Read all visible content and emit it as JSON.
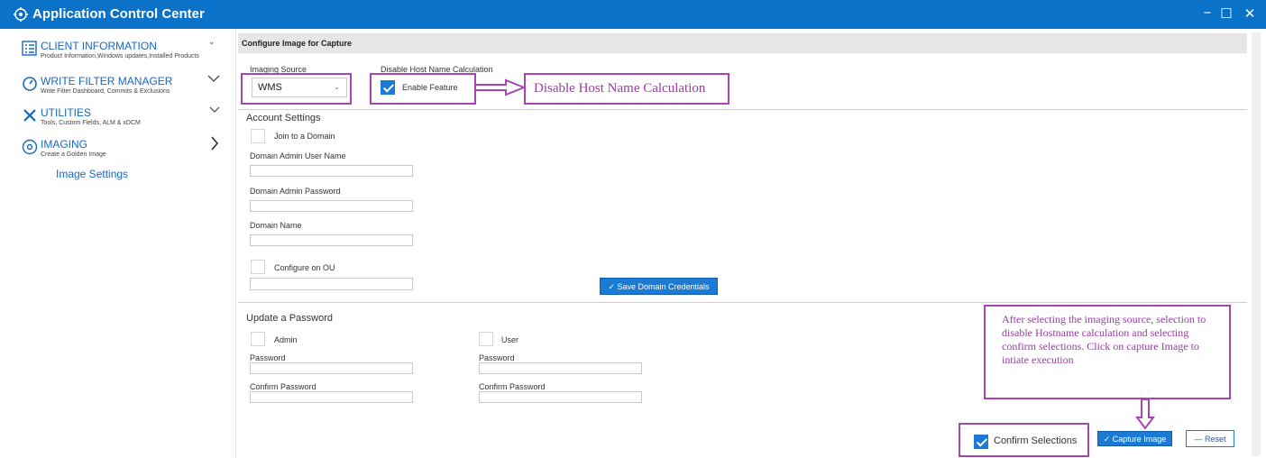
{
  "window": {
    "title": "Application Control Center"
  },
  "sidebar": {
    "items": [
      {
        "title": "CLIENT INFORMATION",
        "subtitle": "Product Information,Windows updates,Installed Products"
      },
      {
        "title": "WRITE FILTER MANAGER",
        "subtitle": "Write Filter Dashboard, Commits & Exclusions"
      },
      {
        "title": "UTILITIES",
        "subtitle": "Tools, Custom Fields, ALM & xDCM"
      },
      {
        "title": "IMAGING",
        "subtitle": "Create a Golden Image"
      }
    ],
    "sub_item": "Image Settings"
  },
  "main": {
    "header": "Configure Image for Capture",
    "imaging_source": {
      "label": "Imaging Source",
      "value": "WMS"
    },
    "host_name": {
      "label": "Disable Host Name Calculation",
      "checkbox_label": "Enable Feature",
      "checked": true
    },
    "account": {
      "title": "Account Settings",
      "join_domain": "Join to a Domain",
      "admin_user": "Domain Admin User Name",
      "admin_password": "Domain Admin Password",
      "domain_name": "Domain Name",
      "configure_ou": "Configure on OU",
      "save_button": "✓ Save Domain Credentials"
    },
    "password": {
      "title": "Update a Password",
      "admin": "Admin",
      "user": "User",
      "password_label": "Password",
      "confirm_label": "Confirm Password"
    },
    "confirm_selections": {
      "label": "Confirm Selections",
      "checked": true
    },
    "capture_button": "✓ Capture Image",
    "reset_button": "— Reset"
  },
  "annotations": {
    "host_name_callout": "Disable Host Name Calculation",
    "instructions": "After selecting the imaging source, selection to disable Hostname calculation and selecting confirm selections. Click on capture Image to intiate execution"
  },
  "colors": {
    "titlebar": "#0a72c9",
    "accent": "#1a7ad4",
    "annotation": "#a844b4"
  }
}
